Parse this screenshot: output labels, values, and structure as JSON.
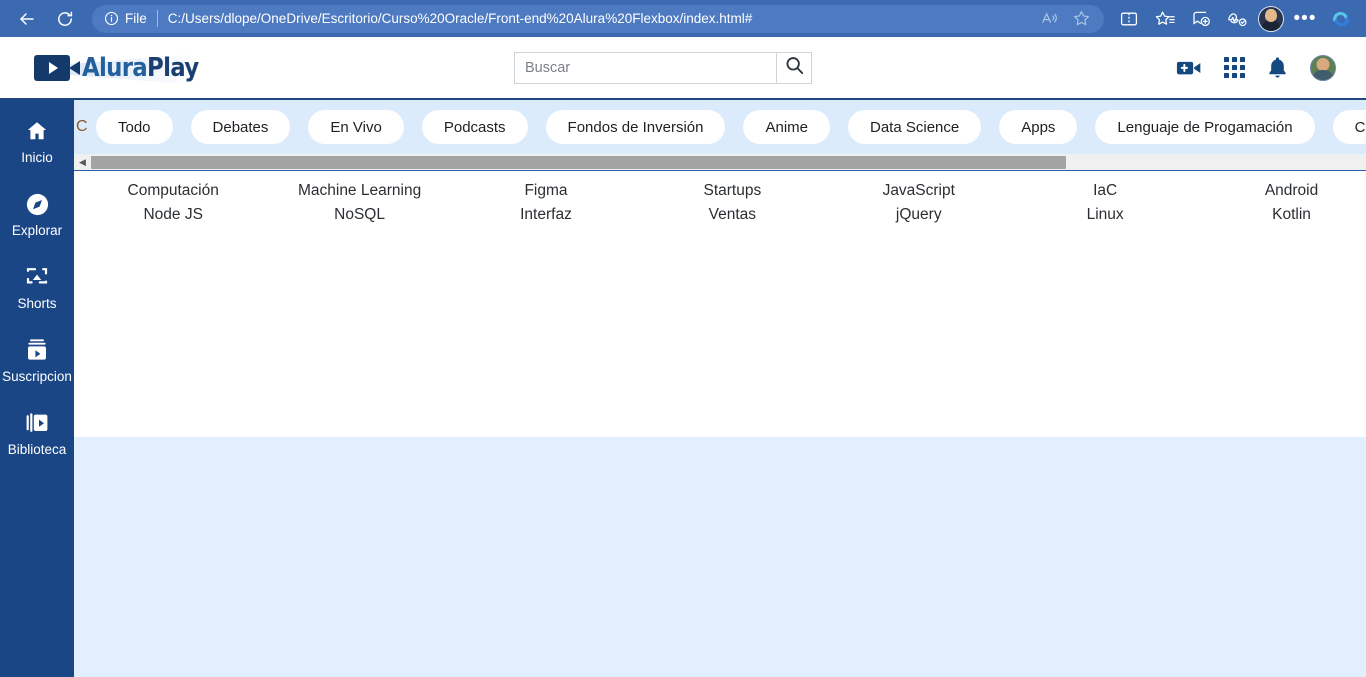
{
  "browser": {
    "back_icon": "back-arrow-icon",
    "reload_icon": "reload-icon",
    "address": {
      "info_icon": "info-icon",
      "scheme_label": "File",
      "url": "C:/Users/dlope/OneDrive/Escritorio/Curso%20Oracle/Front-end%20Alura%20Flexbox/index.html#",
      "read_aloud_icon": "read-aloud-icon",
      "favorite_icon": "star-favorite-icon"
    },
    "tools": [
      {
        "name": "split-screen-icon"
      },
      {
        "name": "favorites-icon"
      },
      {
        "name": "collections-icon"
      },
      {
        "name": "browser-essentials-icon"
      },
      {
        "name": "profile-avatar"
      },
      {
        "name": "settings-more-icon",
        "label": "•••"
      },
      {
        "name": "copilot-icon"
      }
    ]
  },
  "site": {
    "logo": {
      "alura": "Alura",
      "play": "Play",
      "icon": "video-camera-icon"
    },
    "search": {
      "placeholder": "Buscar",
      "value": "",
      "button_icon": "search-icon"
    },
    "header_actions": [
      {
        "name": "create-video-icon"
      },
      {
        "name": "apps-grid-icon"
      },
      {
        "name": "notifications-bell-icon"
      },
      {
        "name": "user-avatar"
      }
    ]
  },
  "sidebar": {
    "items": [
      {
        "label": "Inicio",
        "icon": "home-icon"
      },
      {
        "label": "Explorar",
        "icon": "compass-icon"
      },
      {
        "label": "Shorts",
        "icon": "shorts-screen-icon"
      },
      {
        "label": "Suscripcion",
        "icon": "subscriptions-icon"
      },
      {
        "label": "Biblioteca",
        "icon": "library-icon"
      }
    ]
  },
  "chips": {
    "clipped_left": "C",
    "items": [
      {
        "label": "Todo"
      },
      {
        "label": "Debates"
      },
      {
        "label": "En Vivo"
      },
      {
        "label": "Podcasts"
      },
      {
        "label": "Fondos de Inversión"
      },
      {
        "label": "Anime"
      },
      {
        "label": "Data Science"
      },
      {
        "label": "Apps"
      },
      {
        "label": "Lenguaje de Progamación"
      },
      {
        "label": "Ci"
      }
    ],
    "vscroll": {
      "up": "▲",
      "down": "▼"
    },
    "hscroll": {
      "left": "◀",
      "right": "▶"
    }
  },
  "categories": [
    {
      "top": "",
      "mid": "Computación",
      "bot": "Node JS"
    },
    {
      "top": "",
      "mid": "Machine Learning",
      "bot": "NoSQL"
    },
    {
      "top": "",
      "mid": "Figma",
      "bot": "Interfaz"
    },
    {
      "top": "",
      "mid": "Startups",
      "bot": "Ventas"
    },
    {
      "top": "",
      "mid": "JavaScript",
      "bot": "jQuery"
    },
    {
      "top": "",
      "mid": "IaC",
      "bot": "Linux"
    },
    {
      "top": "",
      "mid": "Android",
      "bot": "Kotlin"
    }
  ],
  "colors": {
    "chrome_blue": "#3b6ab0",
    "navy": "#1b4686",
    "chips_bg": "#dcebfc",
    "panel_blue": "#e1efff"
  }
}
